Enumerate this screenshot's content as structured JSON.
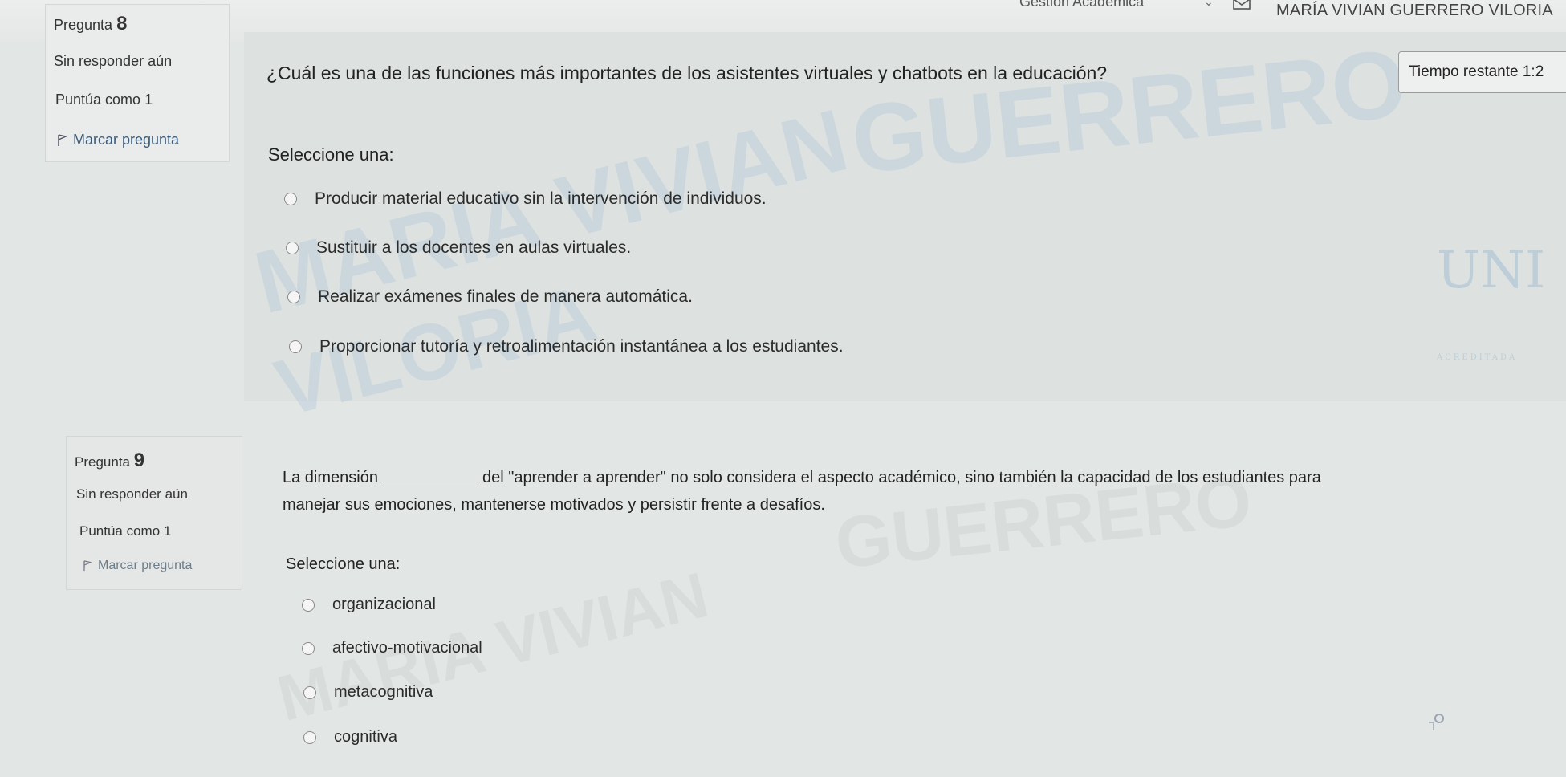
{
  "header": {
    "course_label": "Gestión Académica",
    "user_name": "MARÍA VIVIAN GUERRERO VILORIA"
  },
  "timer": {
    "label": "Tiempo restante 1:2"
  },
  "watermark": {
    "surname": "GUERRERO",
    "name": "MARIA VIVIAN",
    "surname2": "VILORIA"
  },
  "logo": {
    "text": "UNI",
    "subtext": "ACREDITADA"
  },
  "questions": [
    {
      "title_prefix": "Pregunta",
      "number": "8",
      "status": "Sin responder aún",
      "score": "Puntúa como 1",
      "flag_label": "Marcar pregunta",
      "text": "¿Cuál es una de las funciones más importantes de los asistentes virtuales y chatbots en la educación?",
      "select_label": "Seleccione una:",
      "options": [
        "Producir material educativo sin la intervención de individuos.",
        "Sustituir a los docentes en aulas virtuales.",
        "Realizar exámenes finales de manera automática.",
        "Proporcionar tutoría y retroalimentación instantánea a los estudiantes."
      ]
    },
    {
      "title_prefix": "Pregunta",
      "number": "9",
      "status": "Sin responder aún",
      "score": "Puntúa como 1",
      "flag_label": "Marcar pregunta",
      "text_part1": "La dimensión",
      "text_part2": "del \"aprender a aprender\" no solo considera el aspecto académico, sino también la capacidad de los estudiantes para",
      "text_line2": "manejar sus emociones, mantenerse motivados y persistir frente a desafíos.",
      "select_label": "Seleccione una:",
      "options": [
        "organizacional",
        "afectivo-motivacional",
        "metacognitiva",
        "cognitiva"
      ]
    }
  ]
}
